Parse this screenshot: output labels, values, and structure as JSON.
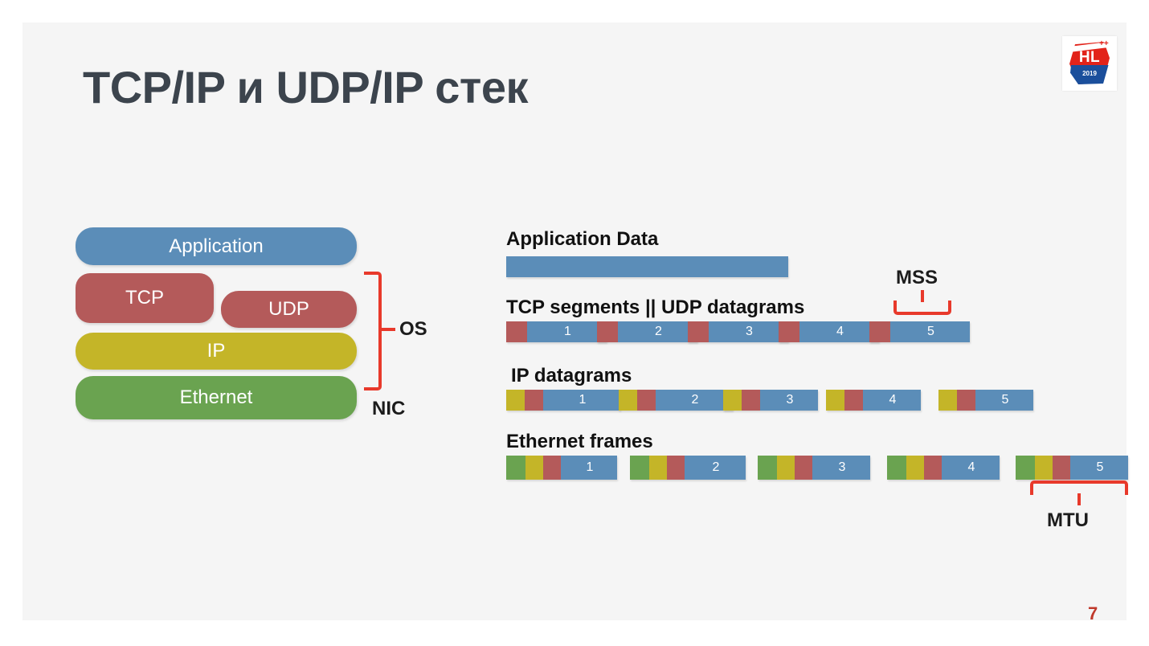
{
  "slide": {
    "title": "TCP/IP и UDP/IP стек",
    "page_number": "7",
    "background_color": "#f5f5f5",
    "title_color": "#3c444d",
    "page_number_color": "#c0392b"
  },
  "logo": {
    "name": "highload-logo",
    "primary_text": "HL",
    "year_text": "2019",
    "plus_text": "++",
    "red": "#e2231a",
    "blue": "#1b4f9c"
  },
  "palette": {
    "blue": "#5b8db8",
    "red": "#b45a5a",
    "yellow": "#c4b528",
    "green": "#6aa350",
    "bracket_red": "#e8392b"
  },
  "stack": {
    "layers": [
      {
        "label": "Application",
        "color": "#5b8db8"
      },
      {
        "label": "TCP",
        "color": "#b45a5a"
      },
      {
        "label": "UDP",
        "color": "#b45a5a"
      },
      {
        "label": "IP",
        "color": "#c4b528"
      },
      {
        "label": "Ethernet",
        "color": "#6aa350"
      }
    ],
    "brackets": [
      {
        "label": "OS",
        "spans": "TCP/UDP through IP"
      }
    ],
    "annotations": [
      {
        "label": "NIC",
        "target": "Ethernet"
      }
    ]
  },
  "packets": {
    "rows": [
      {
        "label": "Application Data",
        "kind": "solid",
        "headers": [],
        "units": []
      },
      {
        "label": "TCP segments || UDP datagrams",
        "kind": "segmented",
        "headers": [
          "red"
        ],
        "units": [
          "1",
          "2",
          "3",
          "4",
          "5"
        ]
      },
      {
        "label": "IP datagrams",
        "kind": "segmented",
        "headers": [
          "yellow",
          "red"
        ],
        "units": [
          "1",
          "2",
          "3",
          "4",
          "5"
        ]
      },
      {
        "label": "Ethernet frames",
        "kind": "segmented",
        "headers": [
          "green",
          "yellow",
          "red"
        ],
        "units": [
          "1",
          "2",
          "3",
          "4",
          "5"
        ]
      }
    ],
    "brackets": [
      {
        "label": "MSS",
        "target": "tcp-segment-5-body",
        "direction": "above"
      },
      {
        "label": "MTU",
        "target": "ethernet-frame-5",
        "direction": "below"
      }
    ]
  }
}
